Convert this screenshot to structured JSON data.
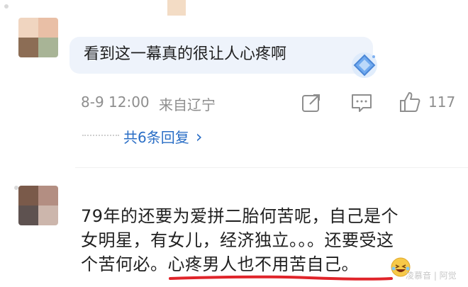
{
  "comment_top": {
    "text": "看到这一幕真的很让人心疼啊",
    "date": "8-9 12:00",
    "location": "来自辽宁",
    "likes": "117",
    "replies_label": "共6条回复",
    "replies_chevron": "›"
  },
  "comment_second": {
    "line1": "79年的还要为爱拼二胎何苦呢，自己是个",
    "line2": "女明星，有女儿，经济独立。。。还要受这",
    "line3_a": "个苦何必。",
    "line3_b": "心疼男人也不用苦自己。"
  },
  "watermark": "凌慕音 | 阿觉",
  "colors": {
    "accent_blue": "#2a6ec6",
    "underline_red": "#e0242a",
    "bubble_bg": "#eef3fb"
  },
  "icons": [
    "share-icon",
    "comment-icon",
    "like-icon",
    "diamond-emoji-icon",
    "laughing-emoji-icon"
  ]
}
